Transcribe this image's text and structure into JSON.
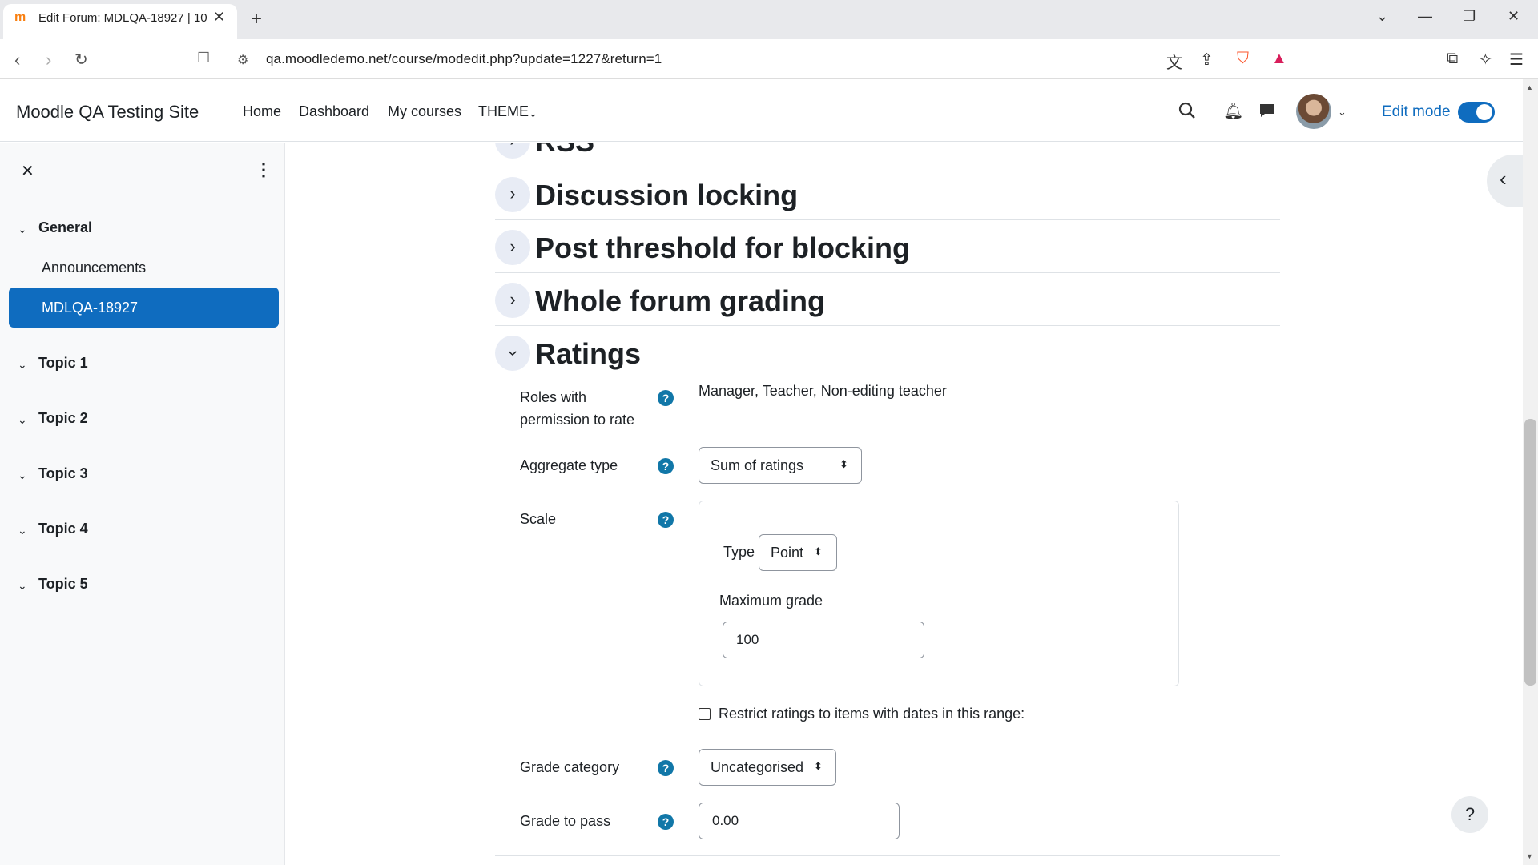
{
  "browser": {
    "tab_title": "Edit Forum: MDLQA-18927 | 10",
    "url": "qa.moodledemo.net/course/modedit.php?update=1227&return=1",
    "new_tab": "+"
  },
  "navbar": {
    "site_name": "Moodle QA Testing Site",
    "links": [
      "Home",
      "Dashboard",
      "My courses",
      "THEME"
    ],
    "edit_mode_label": "Edit mode",
    "edit_mode_on": true
  },
  "drawer": {
    "close": "✕",
    "menu": "⋮",
    "sections": [
      {
        "label": "General",
        "items": [
          "Announcements",
          "MDLQA-18927"
        ],
        "active": "MDLQA-18927"
      },
      {
        "label": "Topic 1"
      },
      {
        "label": "Topic 2"
      },
      {
        "label": "Topic 3"
      },
      {
        "label": "Topic 4"
      },
      {
        "label": "Topic 5"
      }
    ]
  },
  "main": {
    "collapsed_sections": [
      "RSS",
      "Discussion locking",
      "Post threshold for blocking",
      "Whole forum grading"
    ],
    "ratings": {
      "heading": "Ratings",
      "roles_label_line1": "Roles with",
      "roles_label_line2": "permission to rate",
      "roles_value": "Manager, Teacher, Non-editing teacher",
      "aggregate_label": "Aggregate type",
      "aggregate_value": "Sum of ratings",
      "scale_label": "Scale",
      "type_label": "Type",
      "type_value": "Point",
      "max_grade_label": "Maximum grade",
      "max_grade_value": "100",
      "restrict_label": "Restrict ratings to items with dates in this range:",
      "restrict_checked": false,
      "grade_category_label": "Grade category",
      "grade_category_value": "Uncategorised",
      "grade_to_pass_label": "Grade to pass",
      "grade_to_pass_value": "0.00"
    }
  },
  "help_fab": "?",
  "colors": {
    "primary": "#0f6cbf",
    "help_icon": "#1177a8",
    "brave": "#fb542b"
  }
}
